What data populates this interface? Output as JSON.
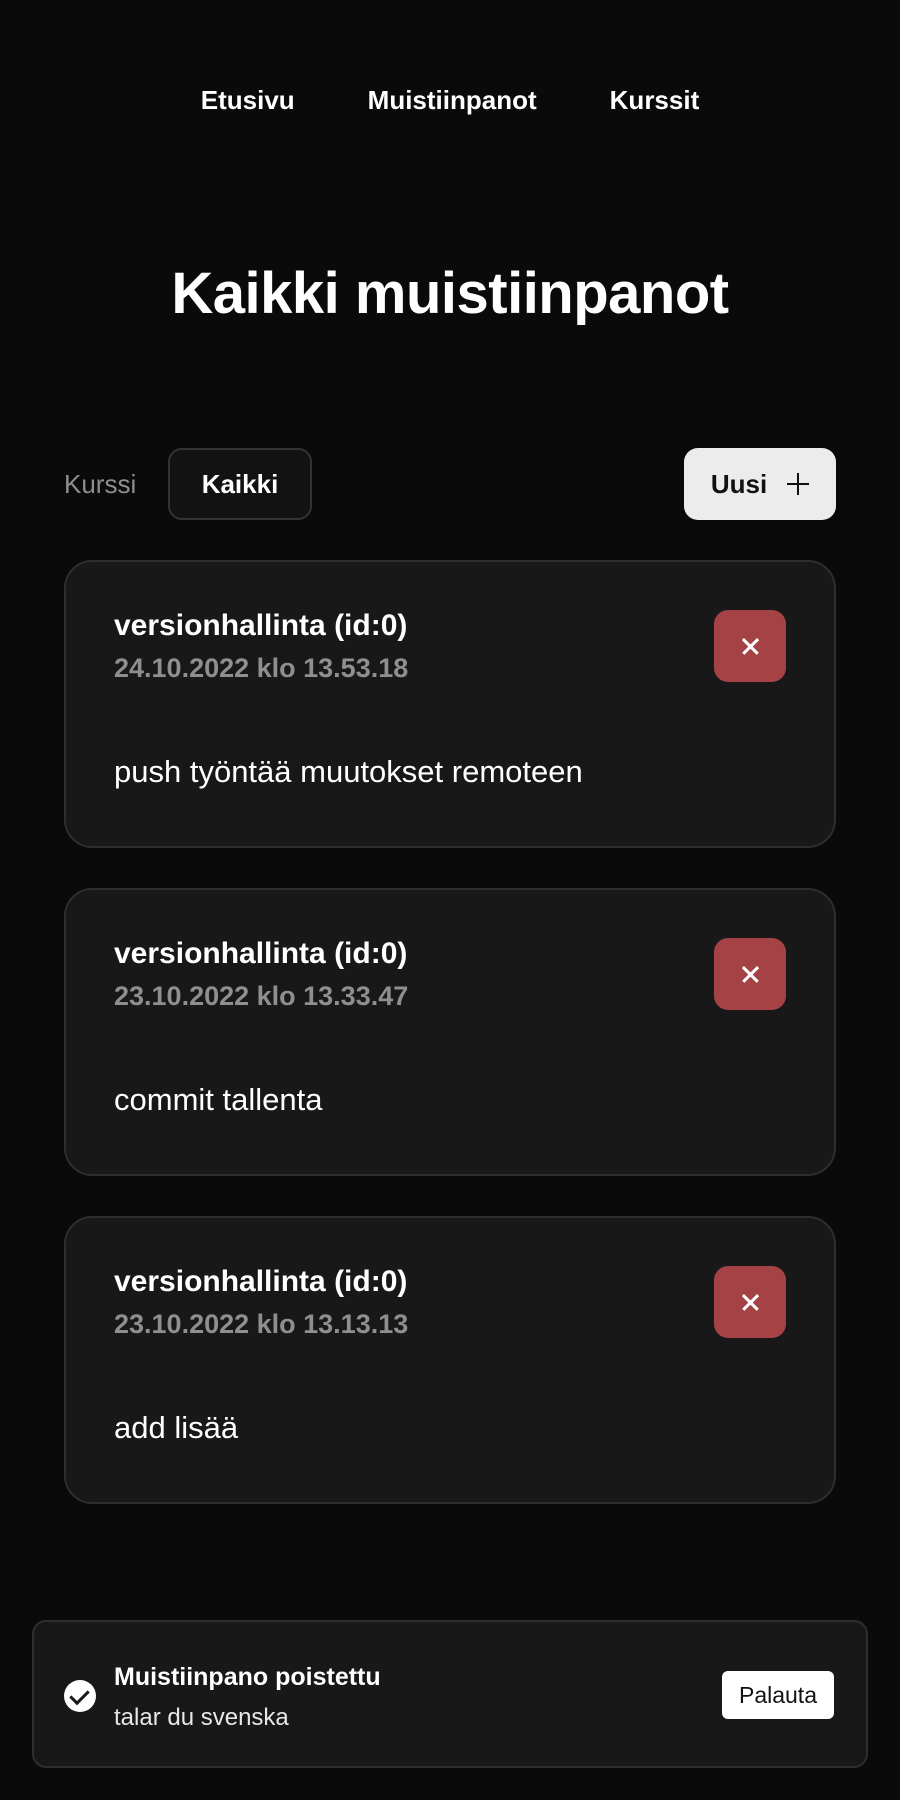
{
  "nav": {
    "items": [
      "Etusivu",
      "Muistiinpanot",
      "Kurssit"
    ]
  },
  "page": {
    "title": "Kaikki muistiinpanot"
  },
  "filter": {
    "label": "Kurssi",
    "selected": "Kaikki"
  },
  "actions": {
    "new_label": "Uusi",
    "new_icon": "plus-icon"
  },
  "notes": [
    {
      "title": "versionhallinta (id:0)",
      "date": "24.10.2022 klo 13.53.18",
      "body": "push työntää muutokset remoteen",
      "delete_icon": "close-icon"
    },
    {
      "title": "versionhallinta (id:0)",
      "date": "23.10.2022 klo 13.33.47",
      "body": "commit tallenta",
      "delete_icon": "close-icon"
    },
    {
      "title": "versionhallinta (id:0)",
      "date": "23.10.2022 klo 13.13.13",
      "body": "add lisää",
      "delete_icon": "close-icon"
    }
  ],
  "toast": {
    "icon": "check-circle-icon",
    "title": "Muistiinpano poistettu",
    "subtitle": "talar du svenska",
    "undo_label": "Palauta"
  },
  "colors": {
    "background": "#0a0a0a",
    "card": "#181818",
    "delete": "#a44246",
    "muted_text": "#8f8f8f",
    "button_light": "#ececec"
  }
}
